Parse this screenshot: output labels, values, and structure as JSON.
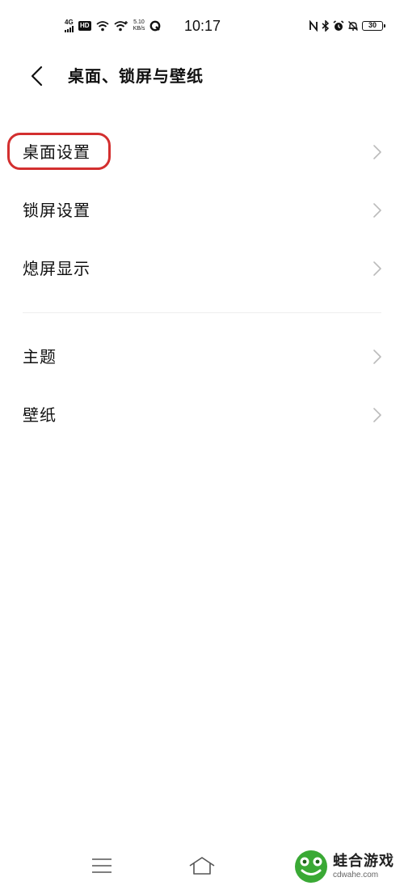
{
  "status_bar": {
    "network_type": "4G",
    "hd_label": "HD",
    "speed_value": "5.10",
    "speed_unit": "KB/s",
    "time": "10:17",
    "battery_level": "30",
    "icons": [
      "signal-icon",
      "wifi-icon",
      "wifi-plus-icon",
      "q-icon",
      "nfc-icon",
      "bluetooth-icon",
      "alarm-icon",
      "mute-icon",
      "battery-icon"
    ]
  },
  "header": {
    "back_icon": "chevron-left-icon",
    "title": "桌面、锁屏与壁纸"
  },
  "list": {
    "group1": [
      {
        "label": "桌面设置",
        "highlighted": true
      },
      {
        "label": "锁屏设置"
      },
      {
        "label": "熄屏显示"
      }
    ],
    "group2": [
      {
        "label": "主题"
      },
      {
        "label": "壁纸"
      }
    ]
  },
  "nav_bar": {
    "icons": [
      "menu-icon",
      "home-icon",
      "back-icon"
    ]
  },
  "watermark": {
    "name": "蛙合游戏",
    "url": "cdwahe.com"
  },
  "colors": {
    "highlight": "#d32f2f",
    "chevron": "#bbbbbb",
    "divider": "#eeeeee",
    "watermark_green": "#3aa935"
  }
}
